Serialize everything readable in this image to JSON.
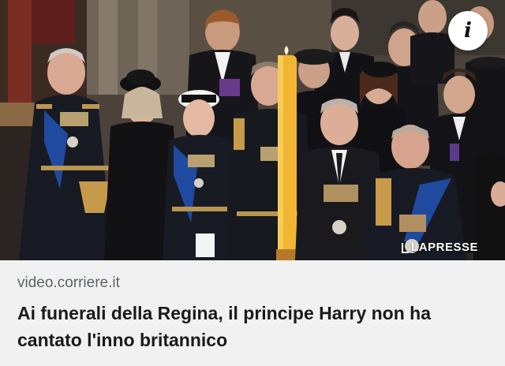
{
  "card": {
    "source": "video.corriere.it",
    "headline": "Ai funerali della Regina, il principe Harry non ha cantato l'inno britannico",
    "info_icon": "info-icon",
    "watermark": "LAPRESSE",
    "photo_subject": "royal-funeral-photo"
  },
  "colors": {
    "caption_bg": "#f1f1f1",
    "source_text": "#5f6368",
    "headline_text": "#1a1a1a",
    "candle": "#f2b632"
  }
}
